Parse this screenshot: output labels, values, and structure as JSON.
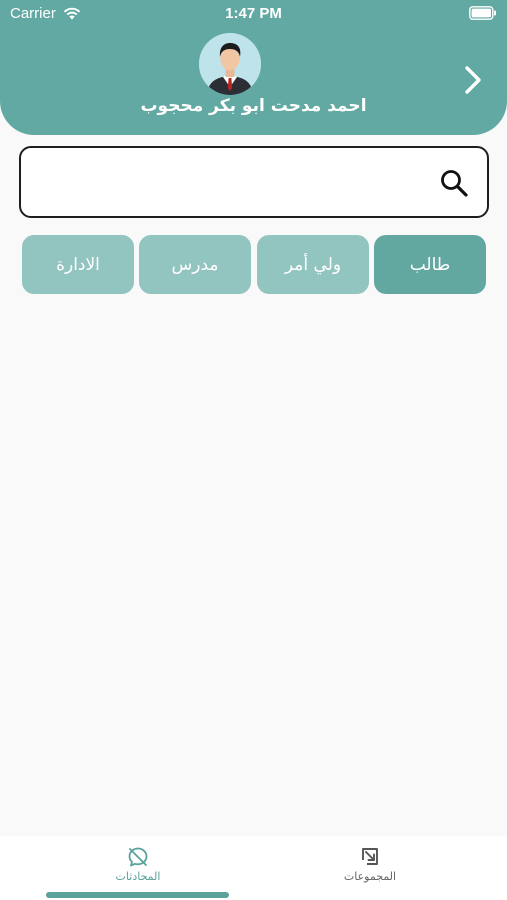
{
  "status_bar": {
    "carrier": "Carrier",
    "time": "1:47 PM"
  },
  "header": {
    "user_name": "احمد مدحت ابو بكر محجوب",
    "avatar_icon": "businessman-avatar-icon",
    "forward_icon": "chevron-right-icon"
  },
  "search": {
    "value": "",
    "placeholder": "",
    "icon": "search-icon"
  },
  "tabs": [
    {
      "label": "طالب",
      "active": true
    },
    {
      "label": "ولي أمر",
      "active": false
    },
    {
      "label": "مدرس",
      "active": false
    },
    {
      "label": "الادارة",
      "active": false
    }
  ],
  "bottom_nav": {
    "items": [
      {
        "label": "المحادثات",
        "icon": "chat-icon",
        "active": true
      },
      {
        "label": "المجموعات",
        "icon": "groups-icon",
        "active": false
      }
    ]
  },
  "colors": {
    "primary": "#63a9a3",
    "tab_active": "#62a8a1",
    "tab_inactive": "#92c4c0",
    "background": "#f9f9f9",
    "nav_active": "#5aa29b"
  }
}
